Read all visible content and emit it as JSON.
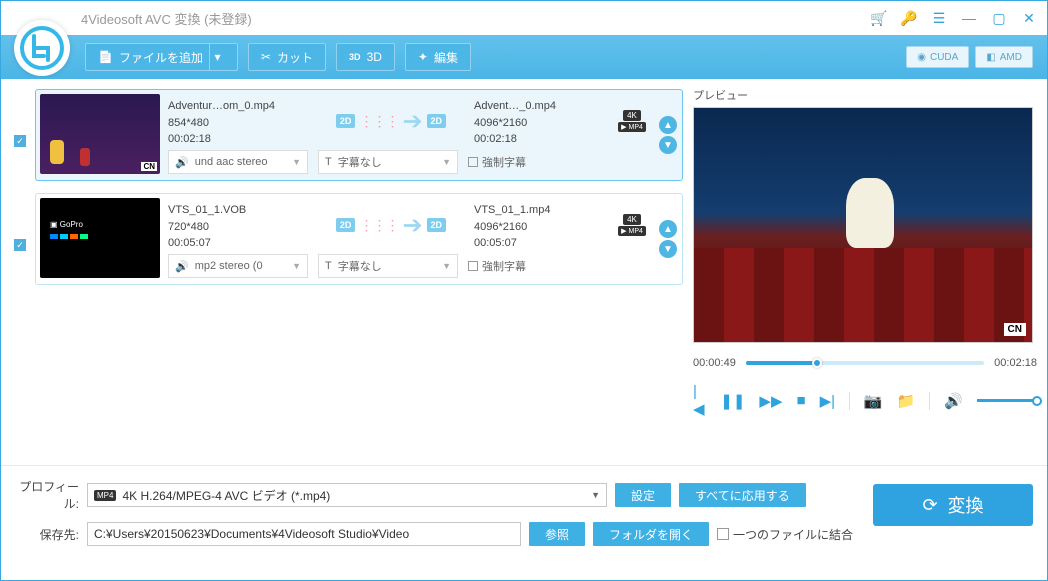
{
  "title": "4Videosoft AVC 変換 (未登録)",
  "toolbar": {
    "add_file": "ファイルを追加",
    "cut": "カット",
    "three_d": "3D",
    "edit": "編集",
    "cuda": "CUDA",
    "amd": "AMD"
  },
  "files": [
    {
      "selected": true,
      "src_name": "Adventur…om_0.mp4",
      "src_res": "854*480",
      "src_dur": "00:02:18",
      "dst_name": "Advent…_0.mp4",
      "dst_res": "4096*2160",
      "dst_dur": "00:02:18",
      "fmt_top": "4K",
      "fmt_bot": "MP4",
      "audio": "und aac stereo",
      "subtitle": "字幕なし",
      "force_sub": "強制字幕"
    },
    {
      "selected": false,
      "src_name": "VTS_01_1.VOB",
      "src_res": "720*480",
      "src_dur": "00:05:07",
      "dst_name": "VTS_01_1.mp4",
      "dst_res": "4096*2160",
      "dst_dur": "00:05:07",
      "fmt_top": "4K",
      "fmt_bot": "MP4",
      "audio": "mp2 stereo (0",
      "subtitle": "字幕なし",
      "force_sub": "強制字幕"
    }
  ],
  "preview": {
    "label": "プレビュー",
    "cur_time": "00:00:49",
    "total_time": "00:02:18",
    "cn_badge": "CN"
  },
  "bottom": {
    "profile_label": "プロフィール:",
    "profile_value": "4K H.264/MPEG-4 AVC ビデオ (*.mp4)",
    "settei": "設定",
    "apply_all": "すべてに応用する",
    "dest_label": "保存先:",
    "dest_value": "C:¥Users¥20150623¥Documents¥4Videosoft Studio¥Video",
    "browse": "参照",
    "open_folder": "フォルダを開く",
    "merge": "一つのファイルに結合",
    "convert": "変換"
  }
}
